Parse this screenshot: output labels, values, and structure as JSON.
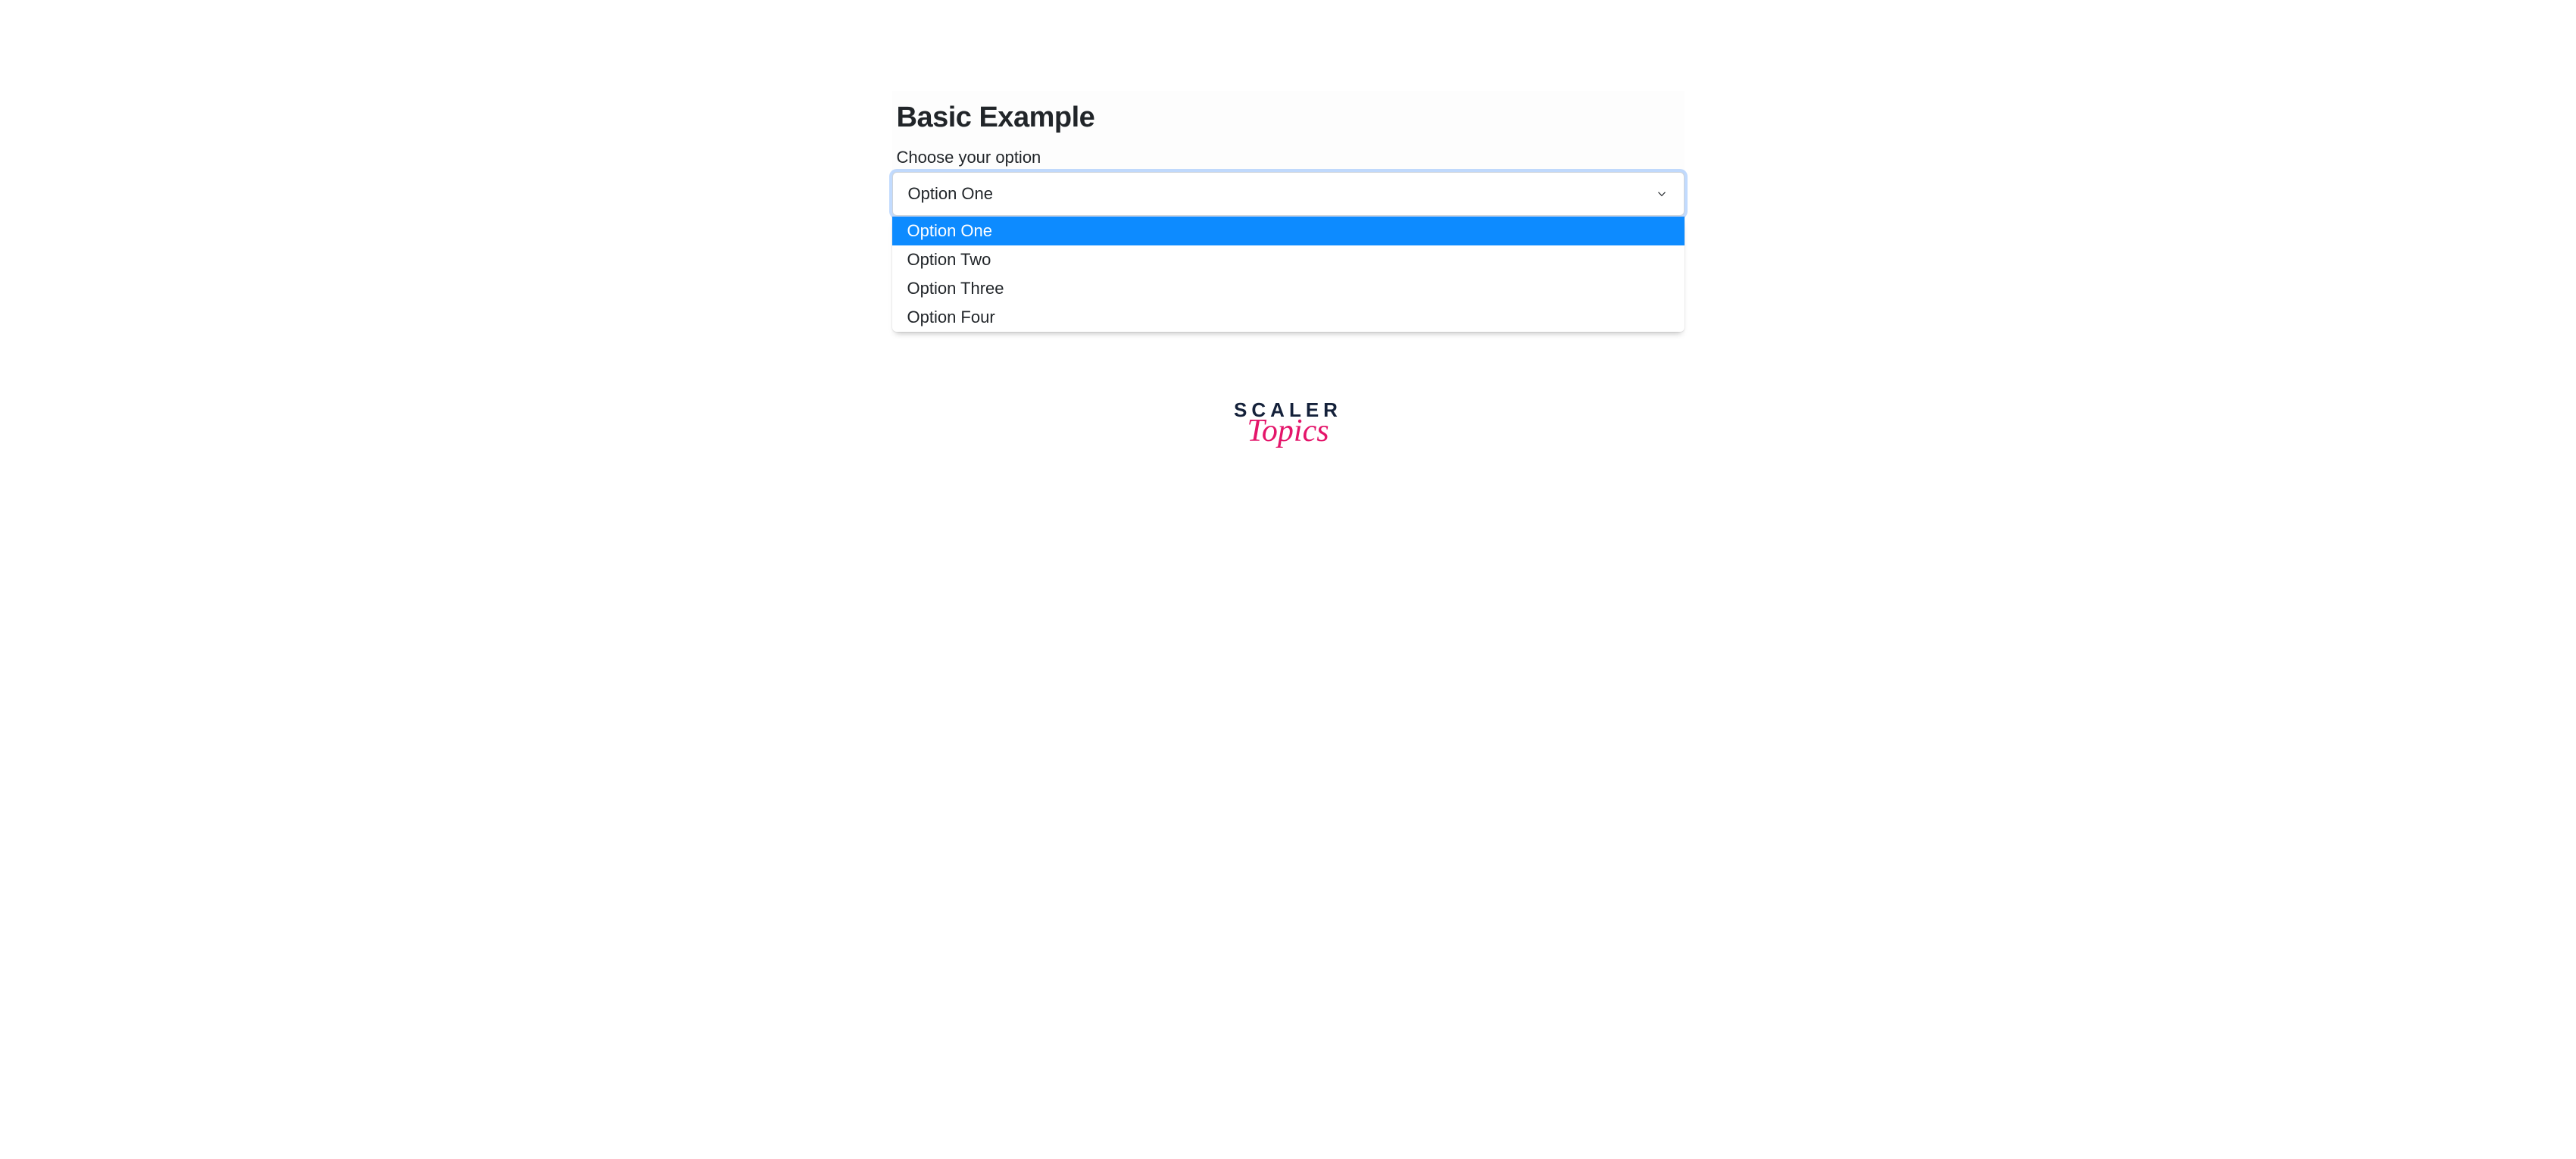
{
  "form": {
    "title": "Basic Example",
    "label": "Choose your option",
    "selected": "Option One",
    "options": [
      "Option One",
      "Option Two",
      "Option Three",
      "Option Four"
    ],
    "selected_index": 0
  },
  "logo": {
    "top": "SCALER",
    "bottom": "Topics"
  },
  "colors": {
    "highlight": "#0d8bff",
    "focus_ring": "rgba(13,110,253,0.25)",
    "text": "#212529",
    "logo_dark": "#14213a",
    "logo_accent": "#e4156a"
  }
}
